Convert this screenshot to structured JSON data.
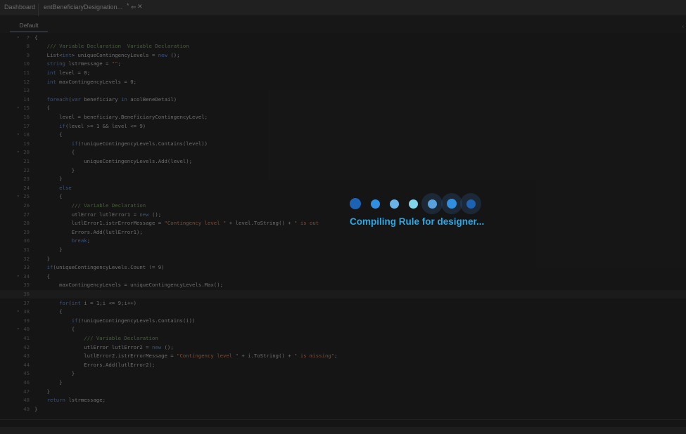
{
  "tabs": {
    "dashboard": "Dashboard",
    "active": "entBeneficiaryDesignation...",
    "modified_marker": "*",
    "pin_glyph": "⇐",
    "close_glyph": "✕"
  },
  "editor_tab": "Default",
  "collapse_glyph": "‹",
  "colors": {
    "loader_text": "#29a8e8",
    "dot_dark": "#1a6fc0",
    "dot_light": "#8fd0f0",
    "keyword": "#4b6a9b",
    "comment": "#5a7a4a",
    "string": "#9a6348"
  },
  "code_lines": [
    {
      "n": "7",
      "fold": true,
      "html": "{"
    },
    {
      "n": "8",
      "html": "    <span class='cm'>/// Variable Declaration  Variable Declaration</span>"
    },
    {
      "n": "9",
      "html": "    List&lt;<span class='kw'>int</span>&gt; uniqueContingencyLevels = <span class='kw'>new</span> ();"
    },
    {
      "n": "10",
      "html": "    <span class='kw'>string</span> lstrmessage = <span class='st'>\"\"</span>;"
    },
    {
      "n": "11",
      "html": "    <span class='kw'>int</span> level = 0;"
    },
    {
      "n": "12",
      "html": "    <span class='kw'>int</span> maxContingencyLevels = 0;"
    },
    {
      "n": "13",
      "html": ""
    },
    {
      "n": "14",
      "html": "    <span class='kw'>foreach</span>(<span class='kw'>var</span> beneficiary <span class='kw'>in</span> acolBeneDetail)"
    },
    {
      "n": "15",
      "fold": true,
      "html": "    {"
    },
    {
      "n": "16",
      "html": "        level = beneficiary.BeneficiaryContingencyLevel;"
    },
    {
      "n": "17",
      "html": "        <span class='kw'>if</span>(level &gt;= 1 &amp;&amp; level &lt;= 9)"
    },
    {
      "n": "18",
      "fold": true,
      "html": "        {"
    },
    {
      "n": "19",
      "html": "            <span class='kw'>if</span>(!uniqueContingencyLevels.Contains(level))"
    },
    {
      "n": "20",
      "fold": true,
      "html": "            {"
    },
    {
      "n": "21",
      "html": "                uniqueContingencyLevels.Add(level);"
    },
    {
      "n": "22",
      "html": "            }"
    },
    {
      "n": "23",
      "html": "        }"
    },
    {
      "n": "24",
      "html": "        <span class='kw'>else</span>"
    },
    {
      "n": "25",
      "fold": true,
      "html": "        {"
    },
    {
      "n": "26",
      "html": "            <span class='cm'>/// Variable Declaration</span>"
    },
    {
      "n": "27",
      "html": "            utlError lutlError1 = <span class='kw'>new</span> ();"
    },
    {
      "n": "28",
      "html": "            lutlError1.istrErrorMessage = <span class='st'>\"Contingency level \"</span> + level.ToString() + <span class='st'>\" is out</span>"
    },
    {
      "n": "29",
      "html": "            Errors.Add(lutlError1);"
    },
    {
      "n": "30",
      "html": "            <span class='kw'>break</span>;"
    },
    {
      "n": "31",
      "html": "        }"
    },
    {
      "n": "32",
      "html": "    }"
    },
    {
      "n": "33",
      "html": "    <span class='kw'>if</span>(uniqueContingencyLevels.Count != 9)"
    },
    {
      "n": "34",
      "fold": true,
      "html": "    {"
    },
    {
      "n": "35",
      "html": "        maxContingencyLevels = uniqueContingencyLevels.Max();"
    },
    {
      "n": "36",
      "hl": true,
      "html": ""
    },
    {
      "n": "37",
      "html": "        <span class='kw'>for</span>(<span class='kw'>int</span> i = 1;i &lt;= 9;i++)"
    },
    {
      "n": "38",
      "fold": true,
      "html": "        {"
    },
    {
      "n": "39",
      "html": "            <span class='kw'>if</span>(!uniqueContingencyLevels.Contains(i))"
    },
    {
      "n": "40",
      "fold": true,
      "html": "            {"
    },
    {
      "n": "41",
      "html": "                <span class='cm'>/// Variable Declaration</span>"
    },
    {
      "n": "42",
      "html": "                utlError lutlError2 = <span class='kw'>new</span> ();"
    },
    {
      "n": "43",
      "html": "                lutlError2.istrErrorMessage = <span class='st'>\"Contingency level \"</span> + i.ToString() + <span class='st'>\" is missing\"</span>;"
    },
    {
      "n": "44",
      "html": "                Errors.Add(lutlError2);"
    },
    {
      "n": "45",
      "html": "            }"
    },
    {
      "n": "46",
      "html": "        }"
    },
    {
      "n": "47",
      "html": "    }"
    },
    {
      "n": "48",
      "html": "    <span class='kw'>return</span> lstrmessage;"
    },
    {
      "n": "49",
      "html": "}"
    }
  ],
  "loader": {
    "text": "Compiling Rule for designer...",
    "dot_count": 7
  }
}
